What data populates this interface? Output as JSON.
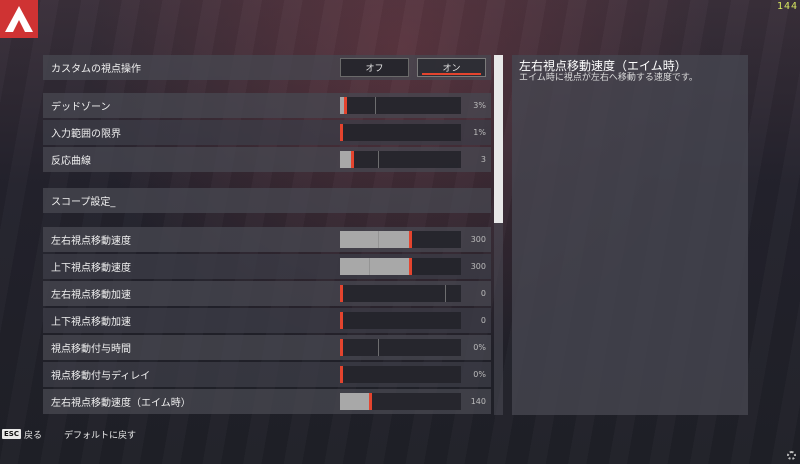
{
  "fps": "144",
  "colors": {
    "accent": "#e4442e",
    "logo": "#cf3333"
  },
  "custom_view": {
    "label": "カスタムの視点操作",
    "off_label": "オフ",
    "on_label": "オン",
    "selected": "on"
  },
  "rows": [
    {
      "label": "デッドゾーン",
      "value": "3%",
      "fill": 0.04,
      "tick": 0.29
    },
    {
      "label": "入力範囲の限界",
      "value": "1%",
      "fill": 0.01,
      "tick": null
    },
    {
      "label": "反応曲線",
      "value": "3",
      "fill": 0.1,
      "tick": 0.31
    }
  ],
  "scope": {
    "label": "スコープ設定_"
  },
  "rows2": [
    {
      "label": "左右視点移動速度",
      "value": "300",
      "fill": 0.58,
      "tick": 0.31
    },
    {
      "label": "上下視点移動速度",
      "value": "300",
      "fill": 0.58,
      "tick": 0.24
    },
    {
      "label": "左右視点移動加速",
      "value": "0",
      "fill": 0.0,
      "tick": 0.87
    },
    {
      "label": "上下視点移動加速",
      "value": "0",
      "fill": 0.0,
      "tick": null
    },
    {
      "label": "視点移動付与時間",
      "value": "0%",
      "fill": 0.0,
      "tick": 0.31
    },
    {
      "label": "視点移動付与ディレイ",
      "value": "0%",
      "fill": 0.0,
      "tick": null
    },
    {
      "label": "左右視点移動速度（エイム時）",
      "value": "140",
      "fill": 0.25,
      "tick": null
    }
  ],
  "description": {
    "title": "左右視点移動速度（エイム時）",
    "text": "エイム時に視点が左右へ移動する速度です。"
  },
  "footer": {
    "esc_key": "ESC",
    "back_label": "戻る",
    "reset_label": "デフォルトに戻す"
  }
}
